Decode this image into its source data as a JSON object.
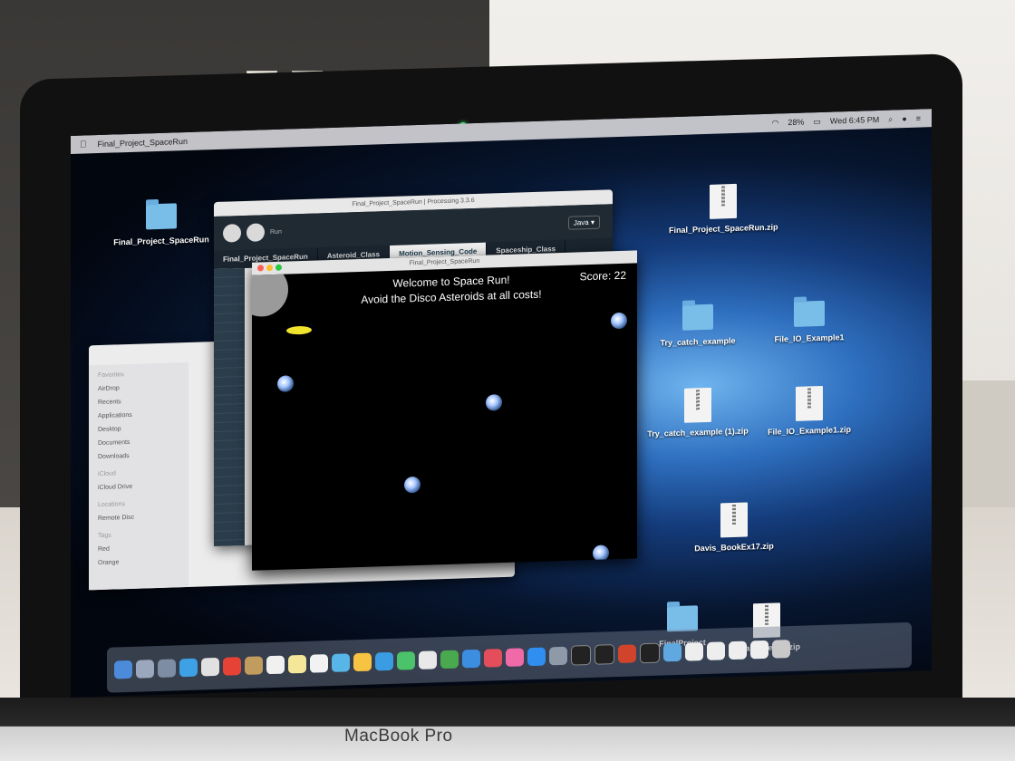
{
  "device": {
    "brand_label": "MacBook Pro"
  },
  "menubar": {
    "app_name": "Final_Project_SpaceRun",
    "battery": "28%",
    "clock": "Wed 6:45 PM"
  },
  "desktop_icons": [
    {
      "kind": "folder",
      "label": "Final_Project_SpaceRun"
    },
    {
      "kind": "zip",
      "label": "Final_Project_SpaceRun.zip"
    },
    {
      "kind": "folder",
      "label": "Try_catch_example"
    },
    {
      "kind": "folder",
      "label": "File_IO_Example1"
    },
    {
      "kind": "zip",
      "label": "Try_catch_example (1).zip"
    },
    {
      "kind": "zip",
      "label": "File_IO_Example1.zip"
    },
    {
      "kind": "zip",
      "label": "Davis_BookEx17.zip"
    },
    {
      "kind": "folder",
      "label": "FinalProject"
    },
    {
      "kind": "zip",
      "label": "FinalProject 2.zip"
    }
  ],
  "finder": {
    "sidebar": [
      "Favorites",
      "AirDrop",
      "Recents",
      "Applications",
      "Desktop",
      "Documents",
      "Downloads",
      "iCloud",
      "iCloud Drive",
      "Locations",
      "Remote Disc",
      "Tags",
      "Red",
      "Orange"
    ]
  },
  "ide": {
    "title": "Final_Project_SpaceRun | Processing 3.3.6",
    "run_label": "Run",
    "mode": "Java ▾",
    "tabs": [
      "Final_Project_SpaceRun",
      "Asteroid_Class",
      "Motion_Sensing_Code",
      "Spaceship_Class"
    ]
  },
  "sketch": {
    "title": "Final_Project_SpaceRun",
    "welcome_line1": "Welcome to Space Run!",
    "welcome_line2": "Avoid the Disco Asteroids at all costs!",
    "score_label": "Score:",
    "score_value": "22"
  }
}
